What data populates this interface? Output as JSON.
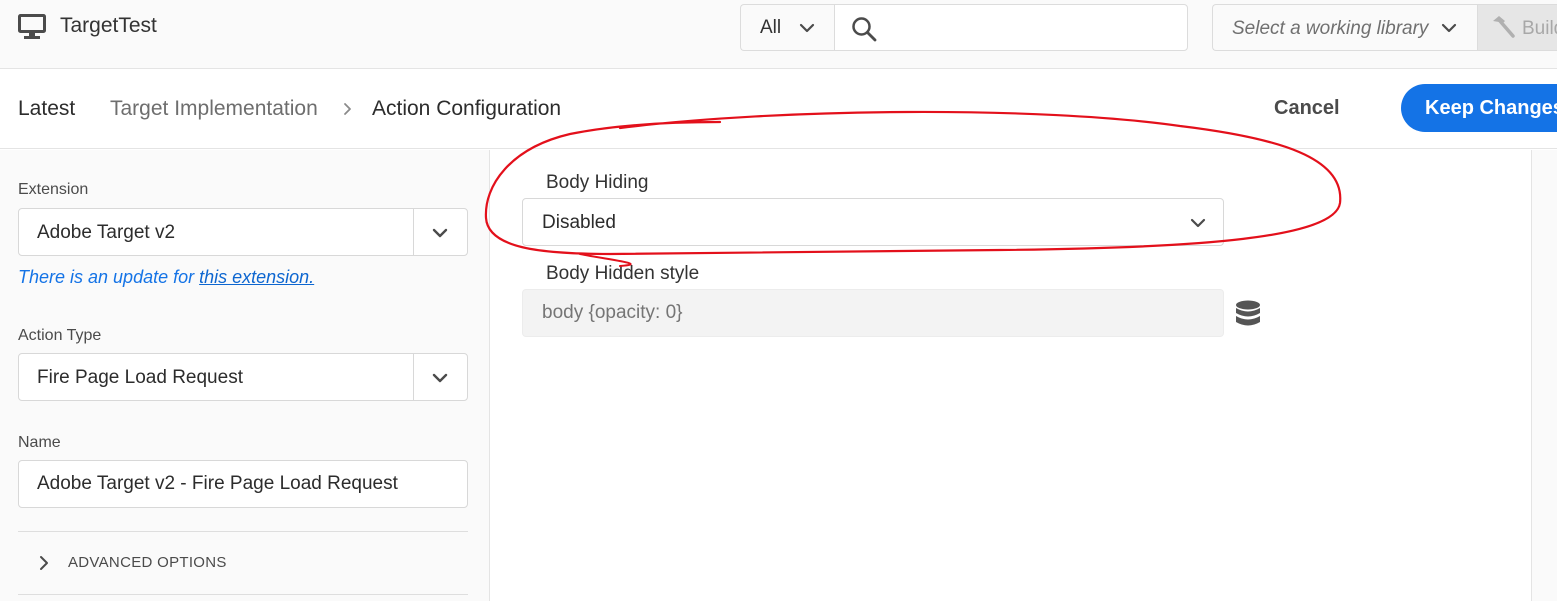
{
  "topbar": {
    "property_name": "TargetTest",
    "scope_label": "All",
    "search_value": "",
    "library_placeholder": "Select a working library",
    "build_label": "Build"
  },
  "header": {
    "breadcrumb": {
      "latest": "Latest",
      "parent": "Target Implementation",
      "current": "Action Configuration"
    },
    "cancel_label": "Cancel",
    "keep_label": "Keep Changes"
  },
  "left_panel": {
    "extension_label": "Extension",
    "extension_value": "Adobe Target v2",
    "update_text": "There is an update for ",
    "update_link": "this extension.",
    "action_type_label": "Action Type",
    "action_type_value": "Fire Page Load Request",
    "name_label": "Name",
    "name_value": "Adobe Target v2 - Fire Page Load Request",
    "advanced_label": "ADVANCED OPTIONS"
  },
  "main": {
    "body_hiding_label": "Body Hiding",
    "body_hiding_value": "Disabled",
    "body_hidden_style_label": "Body Hidden style",
    "body_hidden_style_placeholder": "body {opacity: 0}"
  },
  "colors": {
    "accent": "#1473e6",
    "link": "#0d66d0",
    "annotation": "#e3101b"
  }
}
